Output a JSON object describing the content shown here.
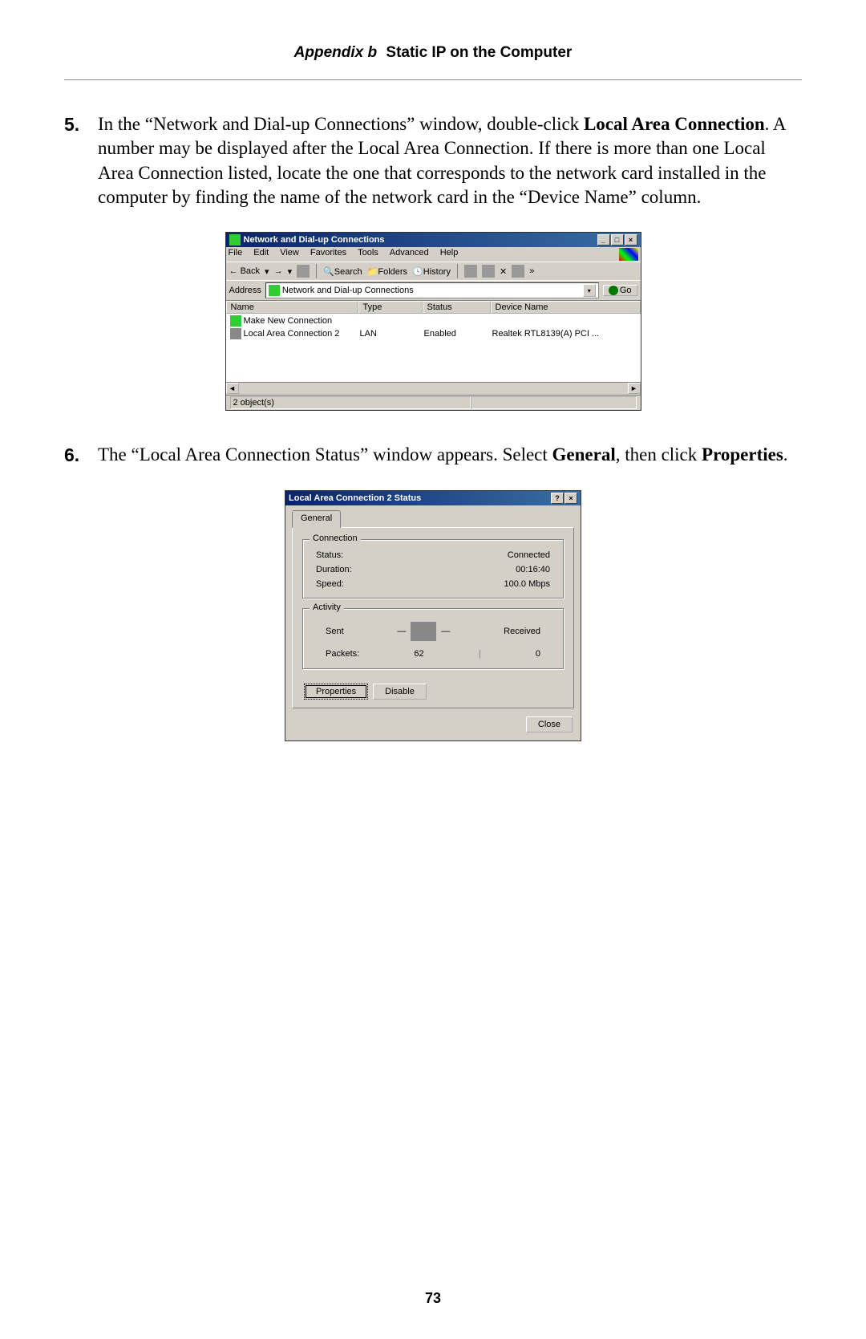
{
  "header": {
    "appendix": "Appendix b",
    "title": "Static IP on the Computer"
  },
  "steps": {
    "s5": {
      "num": "5.",
      "pre": "In the “Network and Dial-up Connections” window, double-click ",
      "bold1": "Local Area Connection",
      "post": ". A number may be displayed after the Local Area Connection. If there is more than one Local Area Connection listed, locate the one that corresponds to the network card installed in the computer by finding the name of the network card in the “Device Name” column."
    },
    "s6": {
      "num": "6.",
      "pre": "The “Local Area Connection Status” window appears. Select ",
      "bold1": "General",
      "mid": ", then click ",
      "bold2": "Properties",
      "post": "."
    }
  },
  "shot1": {
    "title": "Network and Dial-up Connections",
    "menu": {
      "file": "File",
      "edit": "Edit",
      "view": "View",
      "fav": "Favorites",
      "tools": "Tools",
      "adv": "Advanced",
      "help": "Help"
    },
    "toolbar": {
      "back": "Back",
      "search": "Search",
      "folders": "Folders",
      "history": "History",
      "more": "»"
    },
    "address_label": "Address",
    "address_value": "Network and Dial-up Connections",
    "go": "Go",
    "columns": {
      "name": "Name",
      "type": "Type",
      "status": "Status",
      "device": "Device Name"
    },
    "rows": {
      "r1": {
        "name": "Make New Connection"
      },
      "r2": {
        "name": "Local Area Connection 2",
        "type": "LAN",
        "status": "Enabled",
        "device": "Realtek RTL8139(A) PCI ..."
      }
    },
    "status": "2 object(s)"
  },
  "shot2": {
    "title": "Local Area Connection 2 Status",
    "tab": "General",
    "connection": {
      "legend": "Connection",
      "status_l": "Status:",
      "status_v": "Connected",
      "duration_l": "Duration:",
      "duration_v": "00:16:40",
      "speed_l": "Speed:",
      "speed_v": "100.0 Mbps"
    },
    "activity": {
      "legend": "Activity",
      "sent": "Sent",
      "received": "Received",
      "packets_l": "Packets:",
      "packets_sent": "62",
      "packets_recv": "0"
    },
    "buttons": {
      "properties": "Properties",
      "disable": "Disable",
      "close": "Close"
    }
  },
  "page_number": "73"
}
